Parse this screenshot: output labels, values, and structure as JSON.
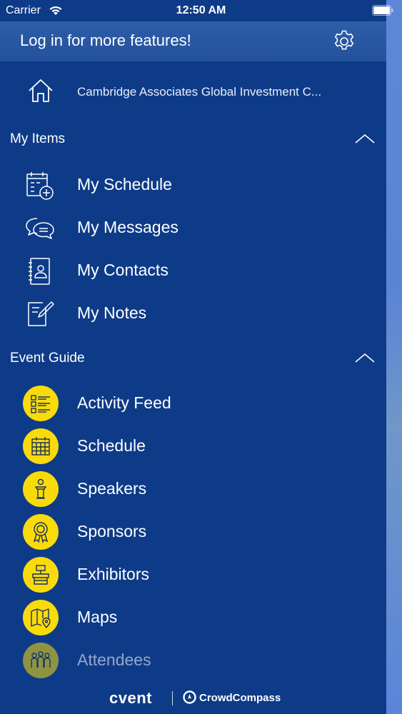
{
  "status_bar": {
    "carrier": "Carrier",
    "time": "12:50 AM"
  },
  "header": {
    "title": "Log in for more features!",
    "settings_icon": "gear-icon"
  },
  "home": {
    "label": "Cambridge Associates Global Investment C...",
    "icon": "home-icon"
  },
  "my_items": {
    "title": "My Items",
    "items": [
      {
        "label": "My Schedule",
        "icon": "calendar-add-icon"
      },
      {
        "label": "My Messages",
        "icon": "chat-bubbles-icon"
      },
      {
        "label": "My Contacts",
        "icon": "address-book-icon"
      },
      {
        "label": "My Notes",
        "icon": "note-pencil-icon"
      }
    ]
  },
  "event_guide": {
    "title": "Event Guide",
    "items": [
      {
        "label": "Activity Feed",
        "icon": "list-feed-icon"
      },
      {
        "label": "Schedule",
        "icon": "calendar-icon"
      },
      {
        "label": "Speakers",
        "icon": "speaker-podium-icon"
      },
      {
        "label": "Sponsors",
        "icon": "award-ribbon-icon"
      },
      {
        "label": "Exhibitors",
        "icon": "exhibitor-booth-icon"
      },
      {
        "label": "Maps",
        "icon": "map-pin-icon"
      },
      {
        "label": "Attendees",
        "icon": "people-group-icon"
      }
    ]
  },
  "footer": {
    "brand_primary": "cvent",
    "brand_secondary": "CrowdCompass"
  },
  "colors": {
    "drawer_bg": "#0e3b88",
    "header_bg": "#2a5aa6",
    "icon_circle": "#fadb0a",
    "text": "#ffffff"
  }
}
